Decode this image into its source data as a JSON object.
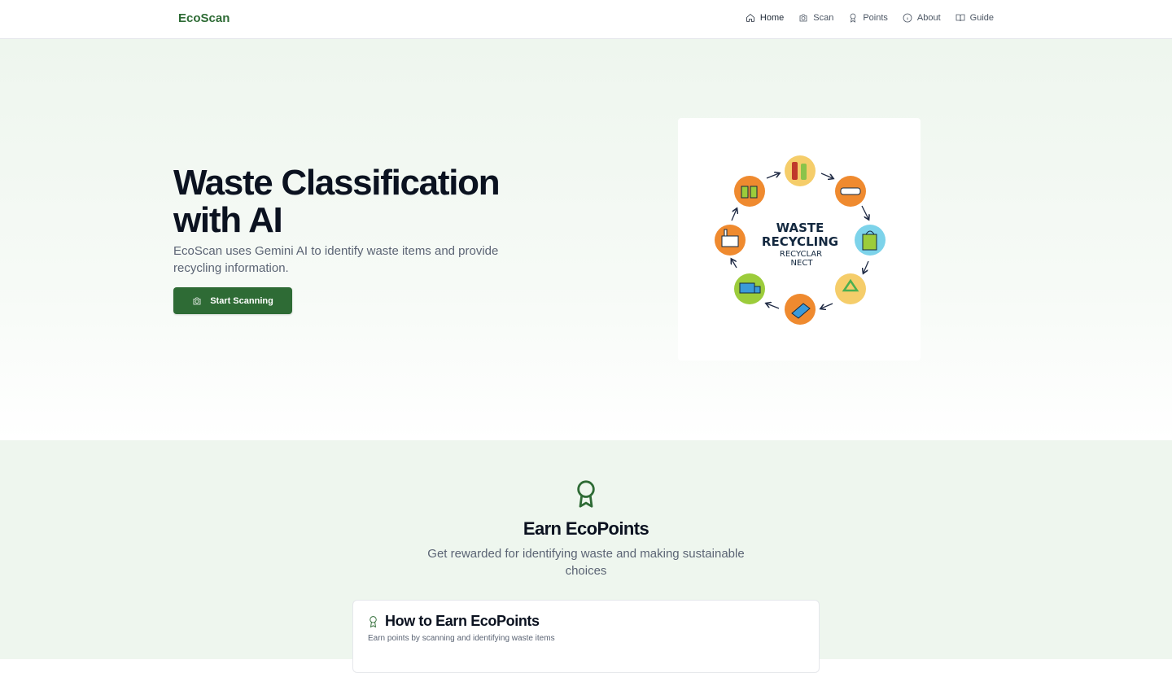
{
  "header": {
    "brand": "EcoScan",
    "nav": [
      {
        "label": "Home",
        "icon": "home-icon",
        "active": true
      },
      {
        "label": "Scan",
        "icon": "camera-icon"
      },
      {
        "label": "Points",
        "icon": "award-icon"
      },
      {
        "label": "About",
        "icon": "info-icon"
      },
      {
        "label": "Guide",
        "icon": "book-icon"
      }
    ]
  },
  "hero": {
    "title": "Waste Classification with AI",
    "subtitle": "EcoScan uses Gemini AI to identify waste items and provide recycling information.",
    "cta_label": "Start Scanning",
    "illustration": {
      "title_line1": "WASTE",
      "title_line2": "RECYCLING",
      "title_line3": "RECYCLAR",
      "title_line4": "NECT"
    }
  },
  "points": {
    "title": "Earn EcoPoints",
    "subtitle": "Get rewarded for identifying waste and making sustainable choices",
    "card": {
      "title": "How to Earn EcoPoints",
      "subtitle": "Earn points by scanning and identifying waste items"
    }
  },
  "colors": {
    "brand": "#2e6b35",
    "hero_bg": "#eef6ee",
    "text_muted": "#5b6474"
  }
}
